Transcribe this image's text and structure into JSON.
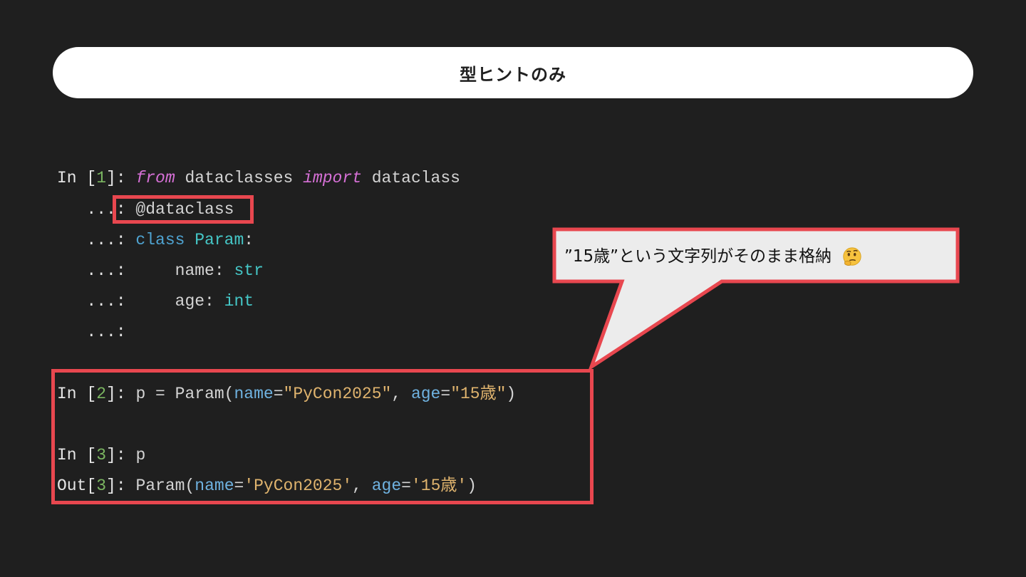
{
  "slide": {
    "title": "型ヒントのみ"
  },
  "code": {
    "line1": {
      "p1": "In [",
      "n": "1",
      "p2": "]: ",
      "kw1": "from",
      "t1": " dataclasses ",
      "kw2": "import",
      "t2": " dataclass"
    },
    "line2": {
      "prompt": "   ...: ",
      "decorator": "@dataclass"
    },
    "line3": {
      "prompt": "   ...: ",
      "kw": "class",
      "sp": " ",
      "name": "Param",
      "colon": ":"
    },
    "line4": {
      "prompt": "   ...: ",
      "indent": "    ",
      "field": "name: ",
      "type": "str"
    },
    "line5": {
      "prompt": "   ...: ",
      "indent": "    ",
      "field": "age: ",
      "type": "int"
    },
    "line6": {
      "prompt": "   ...: "
    },
    "line7": {
      "p1": "In [",
      "n": "2",
      "p2": "]: ",
      "t1": "p = Param(",
      "a1": "name",
      "eq1": "=",
      "s1": "\"PyCon2025\"",
      "c": ", ",
      "a2": "age",
      "eq2": "=",
      "s2": "\"15歳\"",
      "end": ")"
    },
    "line8": {
      "p1": "In [",
      "n": "3",
      "p2": "]: ",
      "t1": "p"
    },
    "line9": {
      "p1": "Out[",
      "n": "3",
      "p2": "]: ",
      "t1": "Param(",
      "a1": "name",
      "eq1": "=",
      "s1": "'PyCon2025'",
      "c": ", ",
      "a2": "age",
      "eq2": "=",
      "s2": "'15歳'",
      "end": ")"
    }
  },
  "callout": {
    "text": "”15歳”という文字列がそのまま格納",
    "emoji": "thinking-face-icon"
  },
  "colors": {
    "background": "#1f1f1f",
    "highlight_border": "#e8474f",
    "callout_fill": "#ececec"
  }
}
